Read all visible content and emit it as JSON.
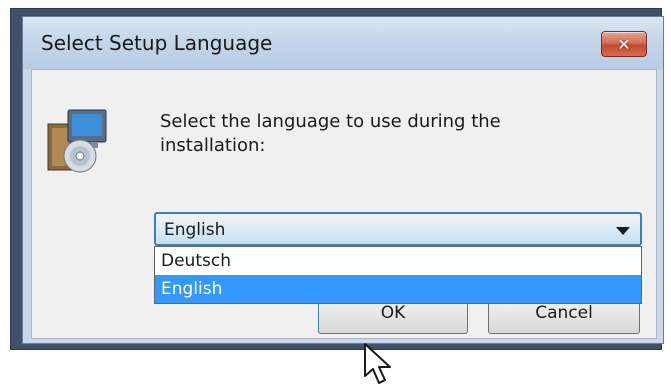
{
  "window": {
    "title": "Select Setup Language",
    "close_symbol": "✕"
  },
  "prompt": "Select the language to use during the installation:",
  "language_select": {
    "selected": "English",
    "options": [
      "Deutsch",
      "English"
    ],
    "highlighted": "English"
  },
  "buttons": {
    "ok_label": "OK",
    "cancel_label": "Cancel"
  },
  "icons": {
    "setup": "setup-computer-cd-icon",
    "dropdown_arrow": "chevron-down-icon",
    "cursor": "mouse-pointer-icon"
  },
  "colors": {
    "title_bar": "#c4d6ea",
    "close_button": "#c24b33",
    "selection_highlight": "#3399ff",
    "combo_border": "#3c7fb1"
  }
}
